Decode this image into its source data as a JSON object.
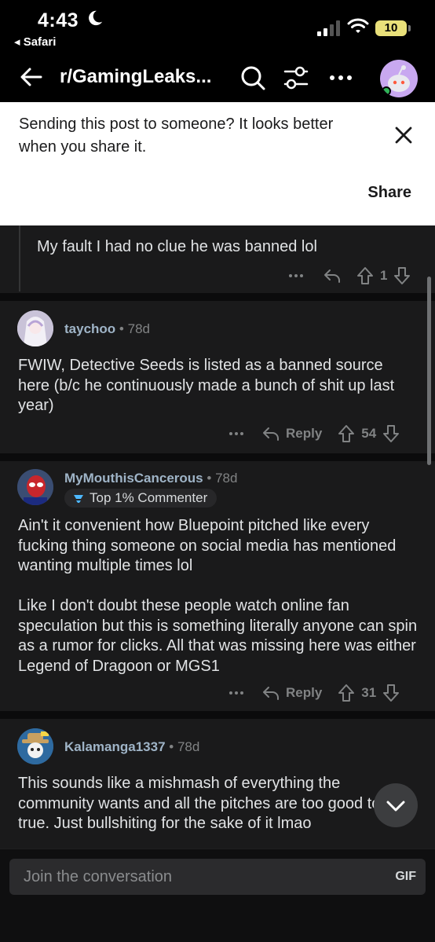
{
  "status_bar": {
    "time": "4:43",
    "back_app": "Safari",
    "battery": "10"
  },
  "nav": {
    "title": "r/GamingLeaks..."
  },
  "banner": {
    "message": "Sending this post to someone? It looks better when you share it.",
    "share_label": "Share"
  },
  "comments": [
    {
      "body": "My fault I had no clue he was banned lol",
      "votes": "1"
    },
    {
      "user": "taychoo",
      "age": "78d",
      "body": "FWIW, Detective Seeds is listed as a banned source here (b/c he continuously made a bunch of shit up last year)",
      "reply_label": "Reply",
      "votes": "54"
    },
    {
      "user": "MyMouthisCancerous",
      "age": "78d",
      "badge": "Top 1% Commenter",
      "body_p1": "Ain't it convenient how Bluepoint pitched like every fucking thing someone on social media has mentioned wanting multiple times lol",
      "body_p2": "Like I don't doubt these people watch online fan speculation but this is something literally anyone can spin as a rumor for clicks. All that was missing here was either Legend of Dragoon or MGS1",
      "reply_label": "Reply",
      "votes": "31"
    },
    {
      "user": "Kalamanga1337",
      "age": "78d",
      "body": "This sounds like a mishmash of everything the community wants and all the pitches are too good to be true. Just bullshiting for the sake of it lmao"
    }
  ],
  "composer": {
    "placeholder": "Join the conversation",
    "gif_label": "GIF"
  },
  "colors": {
    "background": "#1a1a1b",
    "username": "#9fb4c7",
    "online": "#2fb457"
  }
}
